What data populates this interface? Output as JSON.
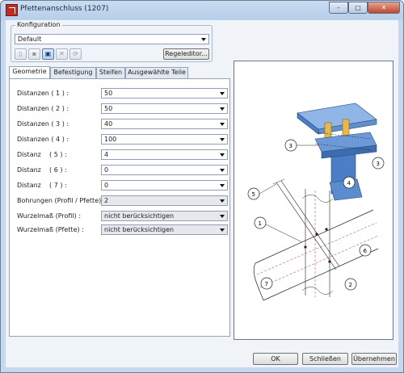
{
  "window": {
    "title": "Pfettenanschluss (1207)",
    "buttons": {
      "minimize": "–",
      "maximize": "□",
      "close": "✕"
    }
  },
  "konfiguration": {
    "legend": "Konfiguration",
    "selected": "Default",
    "regeleditor_label": "Regeleditor..."
  },
  "tabs": [
    {
      "label": "Geometrie",
      "active": true
    },
    {
      "label": "Befestigung",
      "active": false
    },
    {
      "label": "Steifen",
      "active": false
    },
    {
      "label": "Ausgewählte Teile",
      "active": false
    }
  ],
  "geometrie_fields": [
    {
      "label": "Distanzen ( 1 ) :",
      "value": "50"
    },
    {
      "label": "Distanzen ( 2 ) :",
      "value": "50"
    },
    {
      "label": "Distanzen ( 3 ) :",
      "value": "40"
    },
    {
      "label": "Distanzen ( 4 ) :",
      "value": "100"
    },
    {
      "label": "Distanz    ( 5 ) :",
      "value": "4"
    },
    {
      "label": "Distanz    ( 6 ) :",
      "value": "0"
    },
    {
      "label": "Distanz    ( 7 ) :",
      "value": "0"
    },
    {
      "label": "Bohrungen (Profil / Pfette) :",
      "value": "2"
    },
    {
      "label": "Wurzelmaß (Profil) :",
      "value": "nicht berücksichtigen"
    },
    {
      "label": "Wurzelmaß (Pfette) :",
      "value": "nicht berücksichtigen"
    }
  ],
  "preview": {
    "callouts": [
      "3",
      "3",
      "4",
      "5",
      "1",
      "6",
      "7",
      "2"
    ]
  },
  "footer": {
    "ok_label": "OK",
    "close_label": "Schließen",
    "apply_label": "Übernehmen"
  },
  "colors": {
    "accent": "#4f8fdc",
    "steel_blue": "#4a7fc7",
    "plate_yellow": "#e8b84a"
  }
}
